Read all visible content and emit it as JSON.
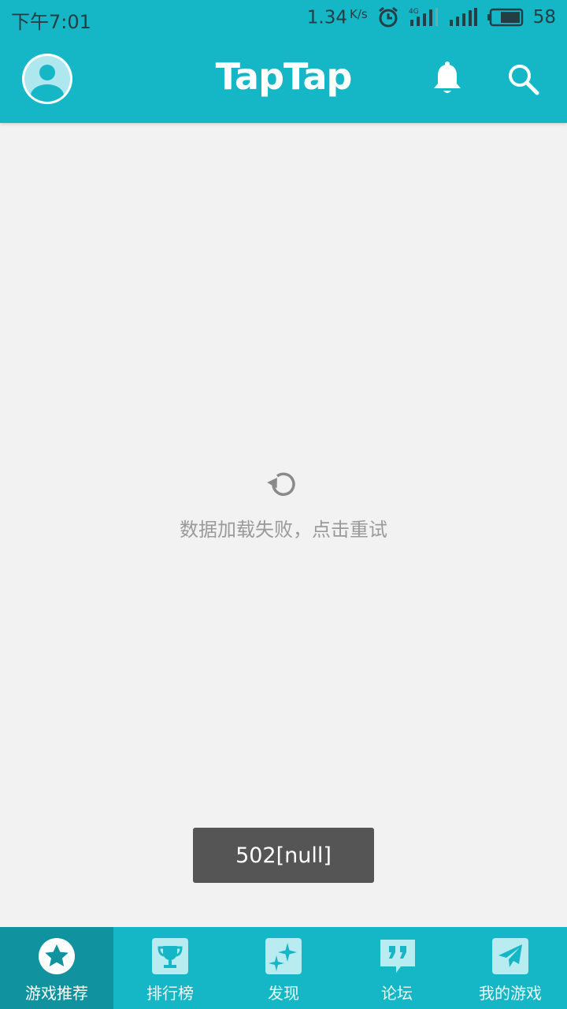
{
  "status_bar": {
    "time": "下午7:01",
    "net_speed": "1.34",
    "net_unit": "K/s",
    "battery": "58"
  },
  "app_bar": {
    "brand": "TapTap",
    "icons": [
      "avatar",
      "bell-icon",
      "search-icon"
    ]
  },
  "main": {
    "error_message": "数据加载失败，点击重试"
  },
  "toast": {
    "message": "502[null]"
  },
  "bottom_nav": {
    "items": [
      {
        "label": "游戏推荐",
        "icon": "star-icon",
        "active": true
      },
      {
        "label": "排行榜",
        "icon": "trophy-icon",
        "active": false
      },
      {
        "label": "发现",
        "icon": "sparkle-icon",
        "active": false
      },
      {
        "label": "论坛",
        "icon": "quote-icon",
        "active": false
      },
      {
        "label": "我的游戏",
        "icon": "paper-plane-icon",
        "active": false
      }
    ]
  },
  "colors": {
    "brand": "#15B7C6",
    "brand_dark": "#10939F",
    "background": "#F2F2F2",
    "toast_bg": "#555555",
    "muted_text": "#9A9A9A"
  }
}
